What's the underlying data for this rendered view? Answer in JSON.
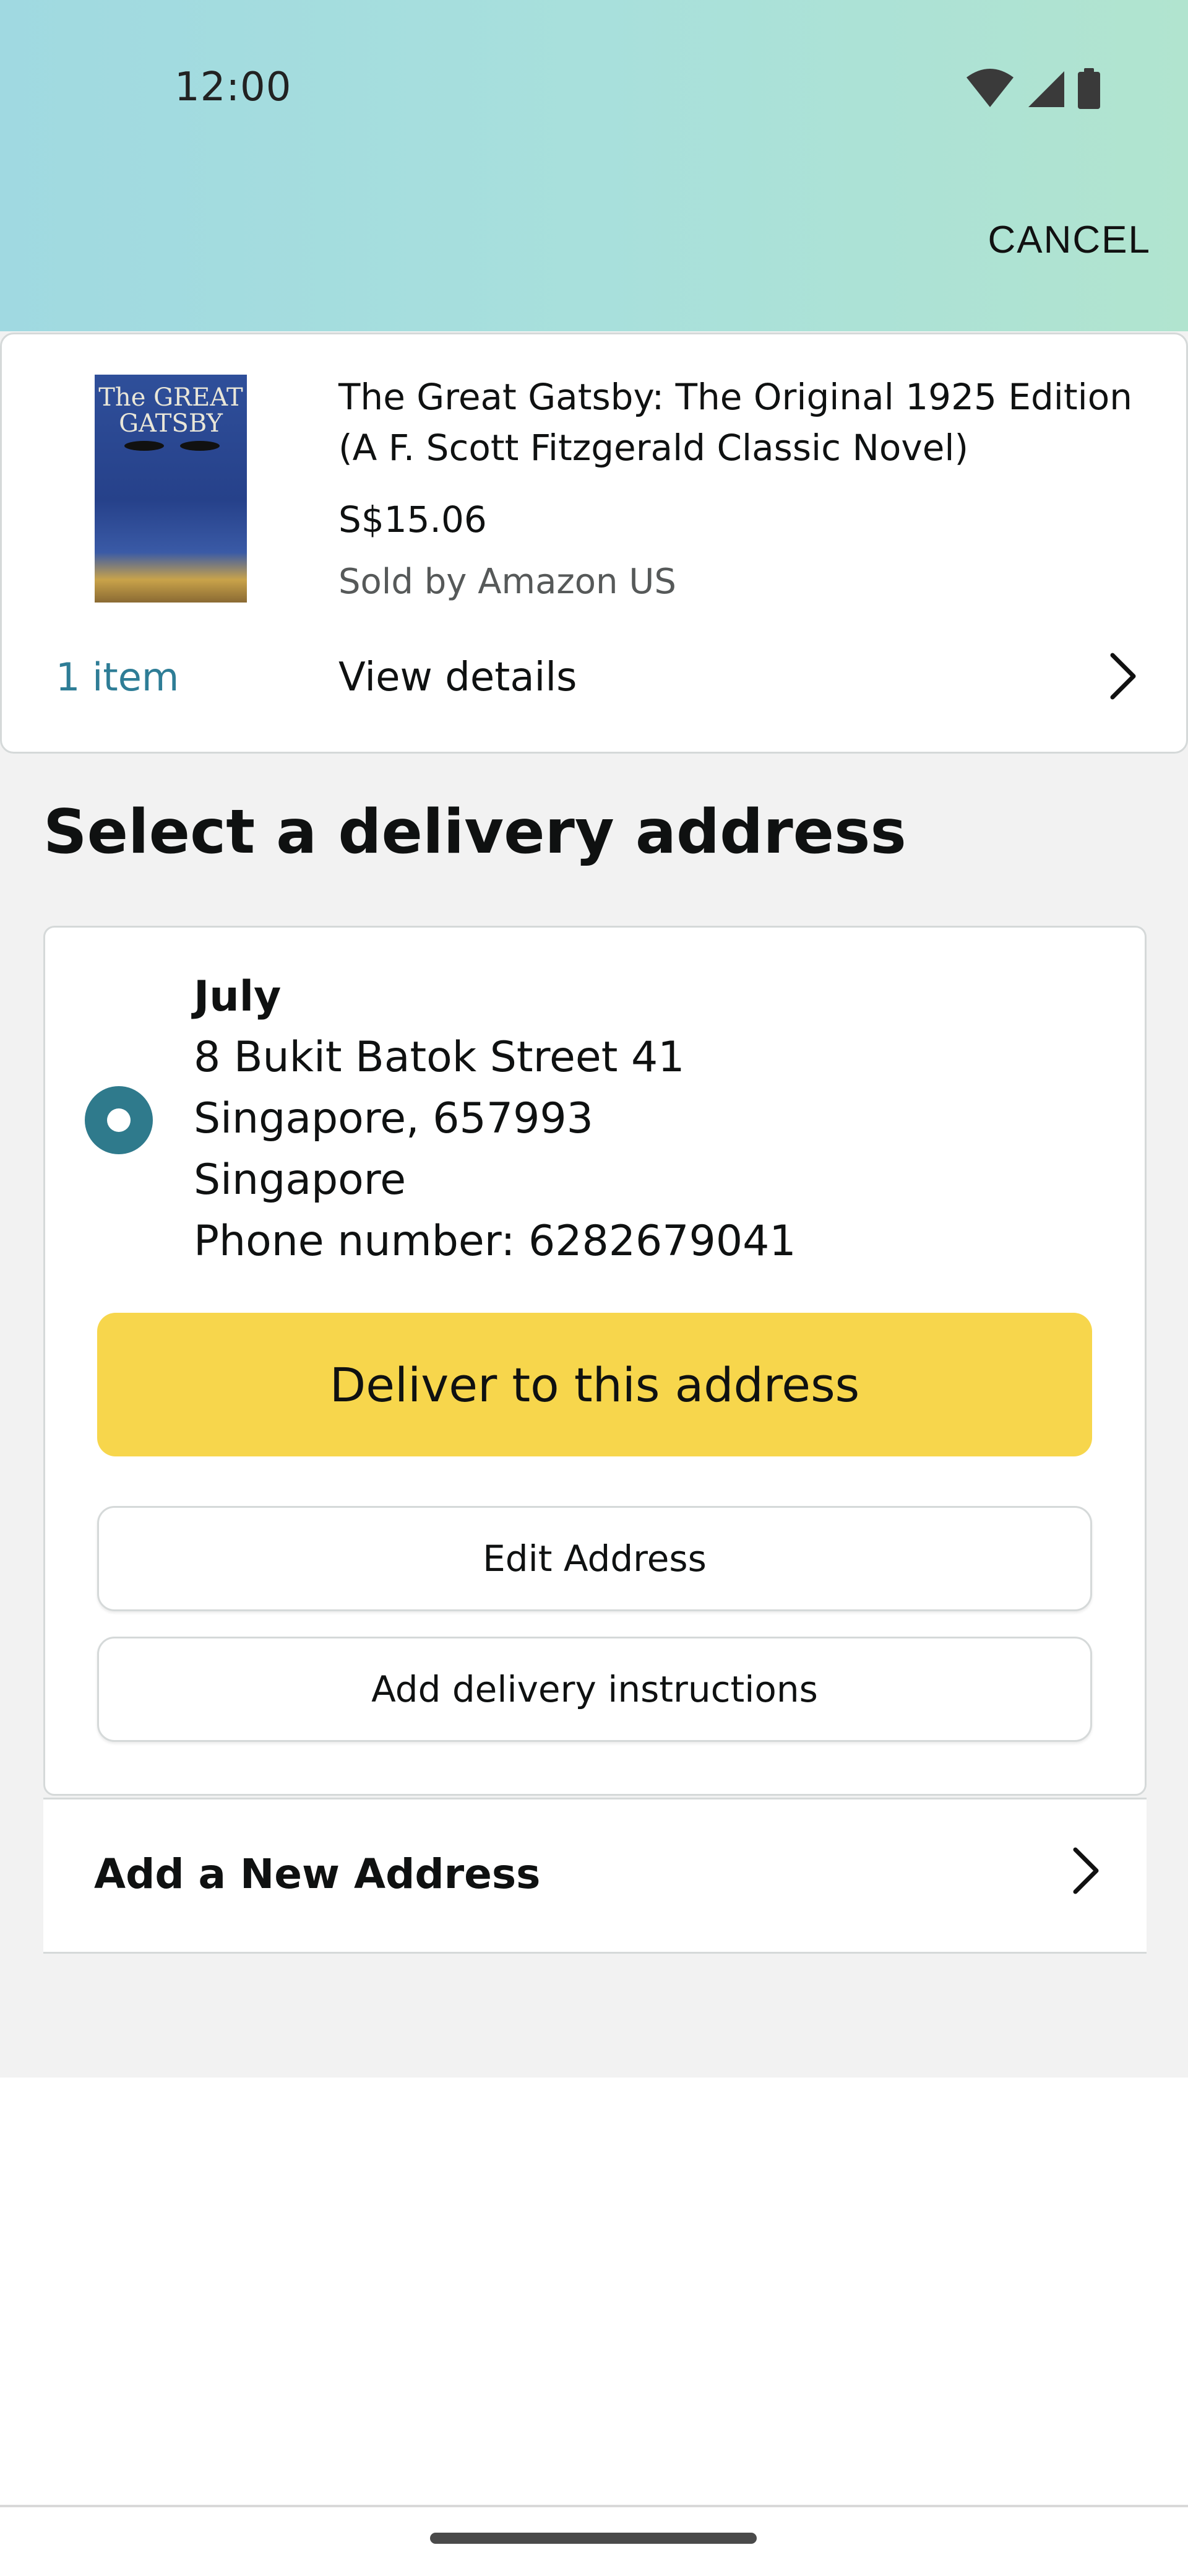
{
  "status_bar": {
    "time": "12:00"
  },
  "header": {
    "cancel_label": "CANCEL"
  },
  "product": {
    "title": "The Great Gatsby: The Original 1925 Edition (A F. Scott Fitzgerald Classic Novel)",
    "price": "S$15.06",
    "seller": "Sold by Amazon US",
    "cover_title_line1": "The GREAT",
    "cover_title_line2": "GATSBY",
    "item_count": "1 item",
    "view_details_label": "View details"
  },
  "section": {
    "title": "Select a delivery address"
  },
  "address": {
    "name": "July",
    "line1": "8 Bukit Batok Street 41",
    "line2": "Singapore, 657993",
    "line3": "Singapore",
    "phone": "Phone number: 6282679041",
    "selected": true
  },
  "buttons": {
    "deliver": "Deliver to this address",
    "edit": "Edit Address",
    "instructions": "Add delivery instructions"
  },
  "add_new": {
    "label": "Add a New Address"
  },
  "colors": {
    "accent_teal": "#2f7a8c",
    "deliver_yellow": "#f7d64c",
    "link_teal": "#2e7d96"
  }
}
